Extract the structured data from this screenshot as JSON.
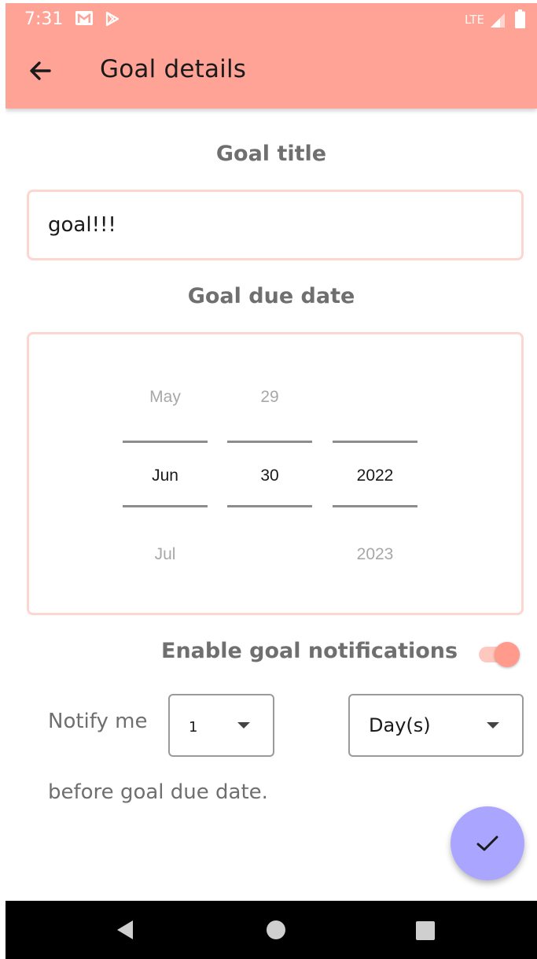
{
  "status_bar": {
    "time": "7:31",
    "network": "LTE",
    "icons": [
      "gmail-icon",
      "play-store-icon",
      "signal-icon",
      "battery-icon"
    ]
  },
  "app_bar": {
    "title": "Goal details",
    "back_icon": "arrow-back-icon",
    "color": "#ffa396"
  },
  "goal_title": {
    "label": "Goal title",
    "value": "goal!!!"
  },
  "due_date": {
    "label": "Goal due date",
    "month": {
      "prev": "May",
      "selected": "Jun",
      "next": "Jul"
    },
    "day": {
      "prev": "29",
      "selected": "30",
      "next": ""
    },
    "year": {
      "prev": "",
      "selected": "2022",
      "next": "2023"
    }
  },
  "notifications": {
    "label": "Enable goal notifications",
    "enabled": true,
    "notify_prefix": "Notify me",
    "quantity": "1",
    "unit": "Day(s)",
    "suffix": "before goal due date."
  },
  "fab": {
    "icon": "check-icon",
    "color": "#aaa6ff"
  },
  "nav_bar": {
    "buttons": [
      "back-triangle-icon",
      "home-circle-icon",
      "recents-square-icon"
    ]
  }
}
